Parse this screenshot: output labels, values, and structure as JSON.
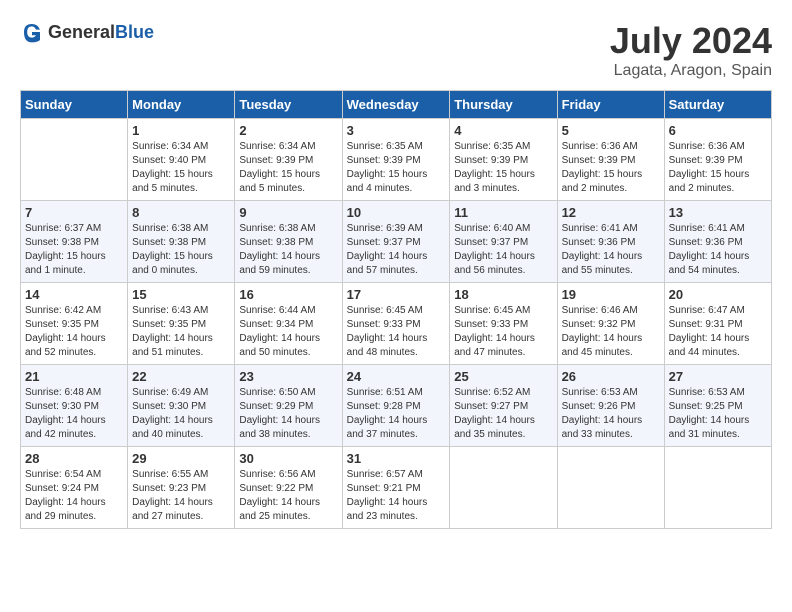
{
  "header": {
    "logo_general": "General",
    "logo_blue": "Blue",
    "month_year": "July 2024",
    "location": "Lagata, Aragon, Spain"
  },
  "days_of_week": [
    "Sunday",
    "Monday",
    "Tuesday",
    "Wednesday",
    "Thursday",
    "Friday",
    "Saturday"
  ],
  "weeks": [
    [
      {
        "day": "",
        "sunrise": "",
        "sunset": "",
        "daylight": ""
      },
      {
        "day": "1",
        "sunrise": "Sunrise: 6:34 AM",
        "sunset": "Sunset: 9:40 PM",
        "daylight": "Daylight: 15 hours and 5 minutes."
      },
      {
        "day": "2",
        "sunrise": "Sunrise: 6:34 AM",
        "sunset": "Sunset: 9:39 PM",
        "daylight": "Daylight: 15 hours and 5 minutes."
      },
      {
        "day": "3",
        "sunrise": "Sunrise: 6:35 AM",
        "sunset": "Sunset: 9:39 PM",
        "daylight": "Daylight: 15 hours and 4 minutes."
      },
      {
        "day": "4",
        "sunrise": "Sunrise: 6:35 AM",
        "sunset": "Sunset: 9:39 PM",
        "daylight": "Daylight: 15 hours and 3 minutes."
      },
      {
        "day": "5",
        "sunrise": "Sunrise: 6:36 AM",
        "sunset": "Sunset: 9:39 PM",
        "daylight": "Daylight: 15 hours and 2 minutes."
      },
      {
        "day": "6",
        "sunrise": "Sunrise: 6:36 AM",
        "sunset": "Sunset: 9:39 PM",
        "daylight": "Daylight: 15 hours and 2 minutes."
      }
    ],
    [
      {
        "day": "7",
        "sunrise": "Sunrise: 6:37 AM",
        "sunset": "Sunset: 9:38 PM",
        "daylight": "Daylight: 15 hours and 1 minute."
      },
      {
        "day": "8",
        "sunrise": "Sunrise: 6:38 AM",
        "sunset": "Sunset: 9:38 PM",
        "daylight": "Daylight: 15 hours and 0 minutes."
      },
      {
        "day": "9",
        "sunrise": "Sunrise: 6:38 AM",
        "sunset": "Sunset: 9:38 PM",
        "daylight": "Daylight: 14 hours and 59 minutes."
      },
      {
        "day": "10",
        "sunrise": "Sunrise: 6:39 AM",
        "sunset": "Sunset: 9:37 PM",
        "daylight": "Daylight: 14 hours and 57 minutes."
      },
      {
        "day": "11",
        "sunrise": "Sunrise: 6:40 AM",
        "sunset": "Sunset: 9:37 PM",
        "daylight": "Daylight: 14 hours and 56 minutes."
      },
      {
        "day": "12",
        "sunrise": "Sunrise: 6:41 AM",
        "sunset": "Sunset: 9:36 PM",
        "daylight": "Daylight: 14 hours and 55 minutes."
      },
      {
        "day": "13",
        "sunrise": "Sunrise: 6:41 AM",
        "sunset": "Sunset: 9:36 PM",
        "daylight": "Daylight: 14 hours and 54 minutes."
      }
    ],
    [
      {
        "day": "14",
        "sunrise": "Sunrise: 6:42 AM",
        "sunset": "Sunset: 9:35 PM",
        "daylight": "Daylight: 14 hours and 52 minutes."
      },
      {
        "day": "15",
        "sunrise": "Sunrise: 6:43 AM",
        "sunset": "Sunset: 9:35 PM",
        "daylight": "Daylight: 14 hours and 51 minutes."
      },
      {
        "day": "16",
        "sunrise": "Sunrise: 6:44 AM",
        "sunset": "Sunset: 9:34 PM",
        "daylight": "Daylight: 14 hours and 50 minutes."
      },
      {
        "day": "17",
        "sunrise": "Sunrise: 6:45 AM",
        "sunset": "Sunset: 9:33 PM",
        "daylight": "Daylight: 14 hours and 48 minutes."
      },
      {
        "day": "18",
        "sunrise": "Sunrise: 6:45 AM",
        "sunset": "Sunset: 9:33 PM",
        "daylight": "Daylight: 14 hours and 47 minutes."
      },
      {
        "day": "19",
        "sunrise": "Sunrise: 6:46 AM",
        "sunset": "Sunset: 9:32 PM",
        "daylight": "Daylight: 14 hours and 45 minutes."
      },
      {
        "day": "20",
        "sunrise": "Sunrise: 6:47 AM",
        "sunset": "Sunset: 9:31 PM",
        "daylight": "Daylight: 14 hours and 44 minutes."
      }
    ],
    [
      {
        "day": "21",
        "sunrise": "Sunrise: 6:48 AM",
        "sunset": "Sunset: 9:30 PM",
        "daylight": "Daylight: 14 hours and 42 minutes."
      },
      {
        "day": "22",
        "sunrise": "Sunrise: 6:49 AM",
        "sunset": "Sunset: 9:30 PM",
        "daylight": "Daylight: 14 hours and 40 minutes."
      },
      {
        "day": "23",
        "sunrise": "Sunrise: 6:50 AM",
        "sunset": "Sunset: 9:29 PM",
        "daylight": "Daylight: 14 hours and 38 minutes."
      },
      {
        "day": "24",
        "sunrise": "Sunrise: 6:51 AM",
        "sunset": "Sunset: 9:28 PM",
        "daylight": "Daylight: 14 hours and 37 minutes."
      },
      {
        "day": "25",
        "sunrise": "Sunrise: 6:52 AM",
        "sunset": "Sunset: 9:27 PM",
        "daylight": "Daylight: 14 hours and 35 minutes."
      },
      {
        "day": "26",
        "sunrise": "Sunrise: 6:53 AM",
        "sunset": "Sunset: 9:26 PM",
        "daylight": "Daylight: 14 hours and 33 minutes."
      },
      {
        "day": "27",
        "sunrise": "Sunrise: 6:53 AM",
        "sunset": "Sunset: 9:25 PM",
        "daylight": "Daylight: 14 hours and 31 minutes."
      }
    ],
    [
      {
        "day": "28",
        "sunrise": "Sunrise: 6:54 AM",
        "sunset": "Sunset: 9:24 PM",
        "daylight": "Daylight: 14 hours and 29 minutes."
      },
      {
        "day": "29",
        "sunrise": "Sunrise: 6:55 AM",
        "sunset": "Sunset: 9:23 PM",
        "daylight": "Daylight: 14 hours and 27 minutes."
      },
      {
        "day": "30",
        "sunrise": "Sunrise: 6:56 AM",
        "sunset": "Sunset: 9:22 PM",
        "daylight": "Daylight: 14 hours and 25 minutes."
      },
      {
        "day": "31",
        "sunrise": "Sunrise: 6:57 AM",
        "sunset": "Sunset: 9:21 PM",
        "daylight": "Daylight: 14 hours and 23 minutes."
      },
      {
        "day": "",
        "sunrise": "",
        "sunset": "",
        "daylight": ""
      },
      {
        "day": "",
        "sunrise": "",
        "sunset": "",
        "daylight": ""
      },
      {
        "day": "",
        "sunrise": "",
        "sunset": "",
        "daylight": ""
      }
    ]
  ]
}
